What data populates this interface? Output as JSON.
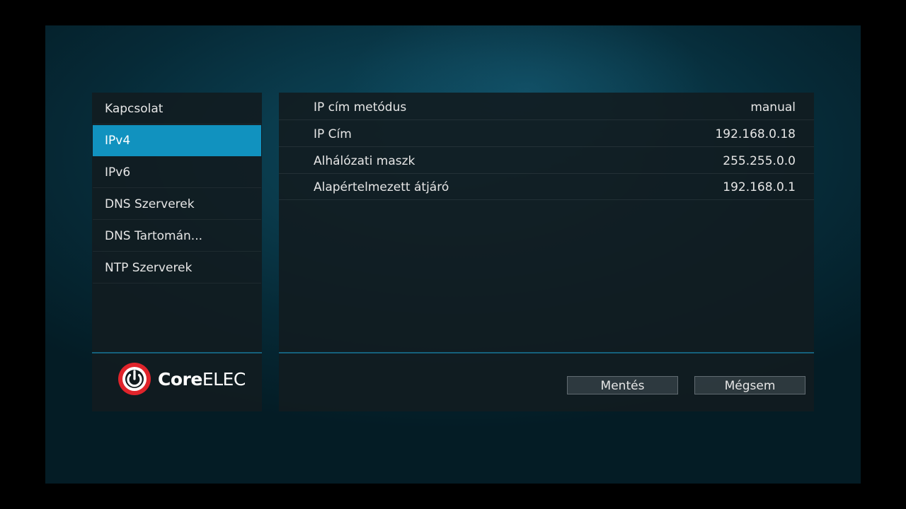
{
  "sidebar": {
    "items": [
      {
        "label": "Kapcsolat"
      },
      {
        "label": "IPv4"
      },
      {
        "label": "IPv6"
      },
      {
        "label": "DNS Szerverek"
      },
      {
        "label": "DNS Tartomán..."
      },
      {
        "label": "NTP Szerverek"
      }
    ],
    "active_index": 1,
    "logo": {
      "bold": "Core",
      "regular": "ELEC",
      "icon": "power-icon"
    }
  },
  "settings": {
    "rows": [
      {
        "label": "IP cím metódus",
        "value": "manual"
      },
      {
        "label": "IP Cím",
        "value": "192.168.0.18"
      },
      {
        "label": "Alhálózati maszk",
        "value": "255.255.0.0"
      },
      {
        "label": "Alapértelmezett átjáró",
        "value": "192.168.0.1"
      }
    ]
  },
  "buttons": {
    "save": "Mentés",
    "cancel": "Mégsem"
  },
  "colors": {
    "accent": "#1192bf",
    "logo_red": "#e0242b"
  }
}
